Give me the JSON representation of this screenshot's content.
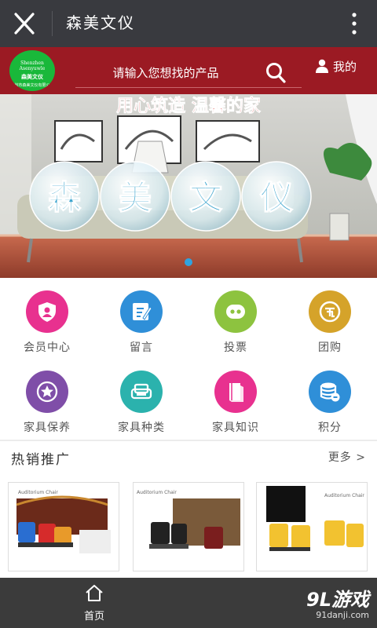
{
  "titlebar": {
    "title": "森美文仪",
    "close_icon": "close-icon",
    "more_icon": "more-vertical-icon"
  },
  "header": {
    "logo": {
      "line1": "Shenzhen Asenyuwle",
      "line2": "森美文仪",
      "line3": "深圳市森美文仪有限公司"
    },
    "search_placeholder": "请输入您想找的产品",
    "mine_label": "我的"
  },
  "banner": {
    "slogan": "用心筑造 温馨的家",
    "bubbles": [
      "森",
      "美",
      "文",
      "仪"
    ]
  },
  "menu": [
    {
      "label": "会员中心",
      "icon": "shield-user-icon",
      "color": "#e8318f"
    },
    {
      "label": "留言",
      "icon": "edit-note-icon",
      "color": "#2f8fd8"
    },
    {
      "label": "投票",
      "icon": "chat-dots-icon",
      "color": "#8dc33f"
    },
    {
      "label": "团购",
      "icon": "group-buy-icon",
      "color": "#d5a32a"
    },
    {
      "label": "家具保养",
      "icon": "star-icon",
      "color": "#7f4ea8"
    },
    {
      "label": "家具种类",
      "icon": "sofa-icon",
      "color": "#2bb2ad"
    },
    {
      "label": "家具知识",
      "icon": "book-icon",
      "color": "#e8318f"
    },
    {
      "label": "积分",
      "icon": "coins-icon",
      "color": "#2f8fd8"
    }
  ],
  "hot": {
    "title": "热销推广",
    "more": "更多 >"
  },
  "products": [
    {
      "caption": "Auditorium Chair",
      "seat_colors": [
        "#2a6ed1",
        "#d62b2b",
        "#e89a2a"
      ]
    },
    {
      "caption": "Auditorium Chair",
      "seat_colors": [
        "#222222",
        "#222222",
        "#7a1e1e"
      ]
    },
    {
      "caption": "Auditorium Chair",
      "seat_colors": [
        "#f2c230",
        "#f2c230",
        "#f2c230"
      ]
    }
  ],
  "bottom_nav": {
    "home_label": "首页",
    "home_icon": "home-icon"
  },
  "watermark": {
    "line1": "9L游戏",
    "line2": "91danji.com"
  }
}
